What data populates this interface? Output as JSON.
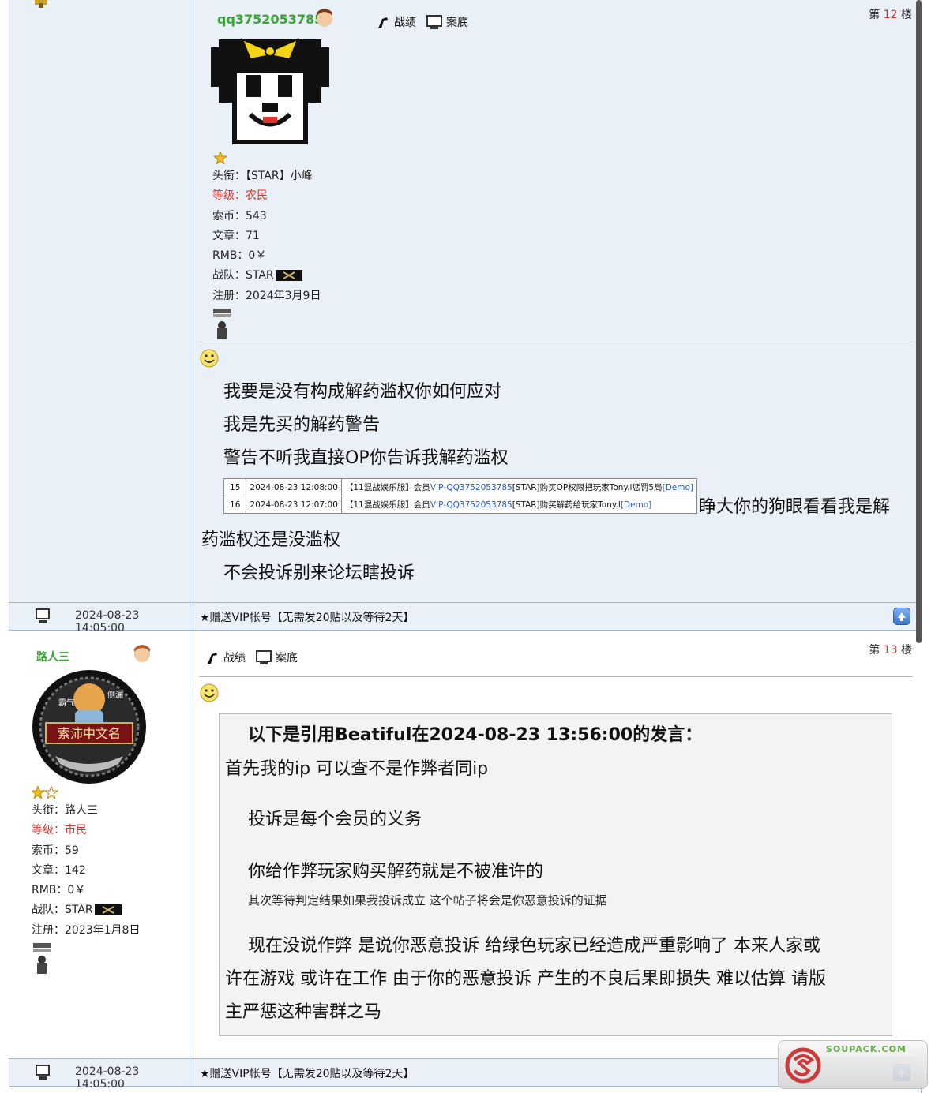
{
  "post1": {
    "floor_prefix": "第",
    "floor_number": "12",
    "floor_suffix": "楼",
    "username": "qq3752053785",
    "toolbar": {
      "record": "战绩",
      "file": "案底"
    },
    "info": {
      "title_label": "头衔：",
      "title_value": "【STAR】小峰",
      "level_label": "等级：",
      "level_value": "农民",
      "coins_label": "索币：",
      "coins_value": "543",
      "articles_label": "文章：",
      "articles_value": "71",
      "rmb_label": "RMB：",
      "rmb_value": "0￥",
      "team_label": "战队：",
      "team_value": "STAR",
      "reg_label": "注册：",
      "reg_value": "2024年3月9日"
    },
    "lines": [
      "我要是没有构成解药滥权你如何应对",
      "我是先买的解药警告",
      "警告不听我直接OP你告诉我解药滥权"
    ],
    "log_rows": [
      {
        "num": "15",
        "time": "2024-08-23 12:08:00",
        "pre": "【11混战娱乐服】会员",
        "link": "VIP-QQ3752053785",
        "post": "[STAR]购买OP权限把玩家Tony.l惩罚5局",
        "demo": "[Demo]"
      },
      {
        "num": "16",
        "time": "2024-08-23 12:07:00",
        "pre": "【11混战娱乐服】会员",
        "link": "VIP-QQ3752053785",
        "post": "[STAR]购买解药给玩家Tony.l",
        "demo": "[Demo]"
      }
    ],
    "after_table": "睁大你的狗眼看看我是解",
    "line_wrap": "药滥权还是没滥权",
    "line_last": "不会投诉别来论坛瞎投诉"
  },
  "footer1": {
    "date": "2024-08-23 14:05:00",
    "link": "★赠送VIP帐号【无需发20贴以及等待2天】"
  },
  "post2": {
    "floor_prefix": "第",
    "floor_number": "13",
    "floor_suffix": "楼",
    "username": "路人三",
    "avatar_text": "索沛中文名",
    "avatar_left": "霸气",
    "avatar_right": "侧漏",
    "toolbar": {
      "record": "战绩",
      "file": "案底"
    },
    "info": {
      "title_label": "头衔：",
      "title_value": "路人三",
      "level_label": "等级：",
      "level_value": "市民",
      "coins_label": "索币：",
      "coins_value": "59",
      "articles_label": "文章：",
      "articles_value": "142",
      "rmb_label": "RMB：",
      "rmb_value": "0￥",
      "team_label": "战队：",
      "team_value": "STAR",
      "reg_label": "注册：",
      "reg_value": "2023年1月8日"
    },
    "quote": {
      "head": "以下是引用Beatiful在2024-08-23 13:56:00的发言：",
      "l1": "首先我的ip 可以查不是作弊者同ip",
      "l2": "投诉是每个会员的义务",
      "l3": "你给作弊玩家购买解药就是不被准许的",
      "l4": "其次等待判定结果如果我投诉成立 这个帖子将会是你恶意投诉的证据",
      "l5a": "现在没说作弊 是说你恶意投诉 给绿色玩家已经造成严重影响了 本来人家或",
      "l5b": "许在游戏 或许在工作 由于你的恶意投诉 产生的不良后果即损失 难以估算 请版",
      "l5c": "主严惩这种害群之马"
    }
  },
  "footer2": {
    "date": "2024-08-23 14:05:00",
    "link": "★赠送VIP帐号【无需发20贴以及等待2天】"
  },
  "watermark": {
    "text": "SOUPACK.COM"
  }
}
